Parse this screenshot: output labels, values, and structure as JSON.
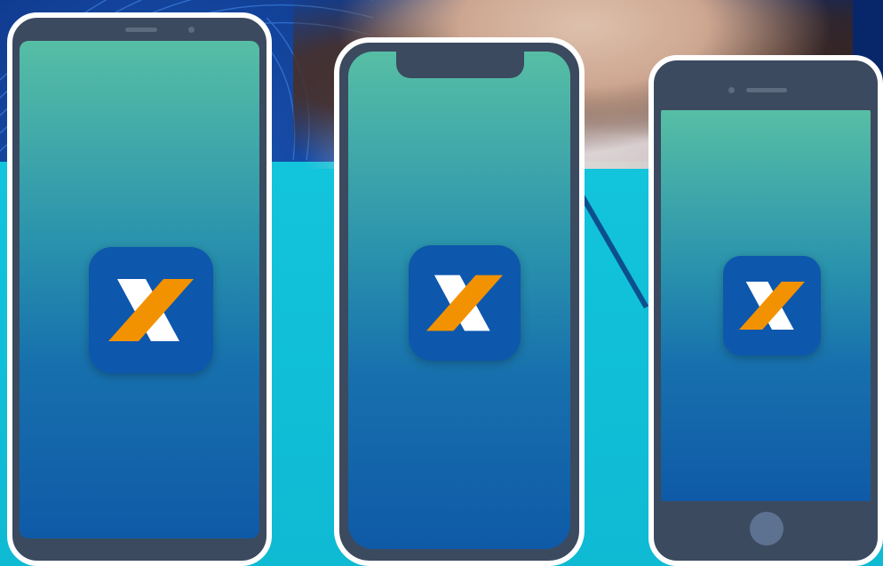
{
  "scene": {
    "description_name": "caixa-app-phones-promo",
    "colors": {
      "background_top": "#0b2e7a",
      "background_bottom": "#12c4dc",
      "phone_frame": "#ffffff",
      "phone_body": "#3b4a5f",
      "screen_gradient_top": "#57bea5",
      "screen_gradient_bottom": "#0f5aa7",
      "app_icon_bg": "#0d57ad",
      "logo_orange": "#f39200",
      "logo_white": "#ffffff"
    }
  },
  "phones": [
    {
      "icon": "caixa-x-logo-icon",
      "style": "fullscreen-android"
    },
    {
      "icon": "caixa-x-logo-icon",
      "style": "notched-iphone"
    },
    {
      "icon": "caixa-x-logo-icon",
      "style": "home-button-iphone"
    }
  ]
}
